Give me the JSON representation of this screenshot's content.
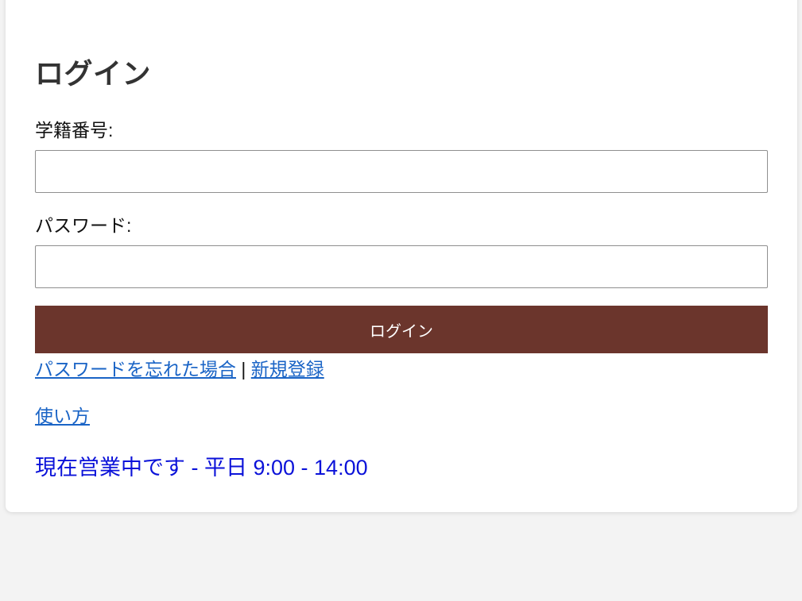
{
  "page": {
    "title": "ログイン"
  },
  "form": {
    "student_id_label": "学籍番号:",
    "student_id_value": "",
    "password_label": "パスワード:",
    "password_value": "",
    "submit_label": "ログイン"
  },
  "links": {
    "forgot_password": "パスワードを忘れた場合",
    "separator": " | ",
    "register": "新規登録",
    "how_to_use": "使い方"
  },
  "status": {
    "text": "現在営業中です - 平日 9:00 - 14:00"
  },
  "colors": {
    "background": "#f3f3f3",
    "card": "#ffffff",
    "button": "#6b352c",
    "link": "#1a64c6",
    "status": "#0b12d9"
  }
}
